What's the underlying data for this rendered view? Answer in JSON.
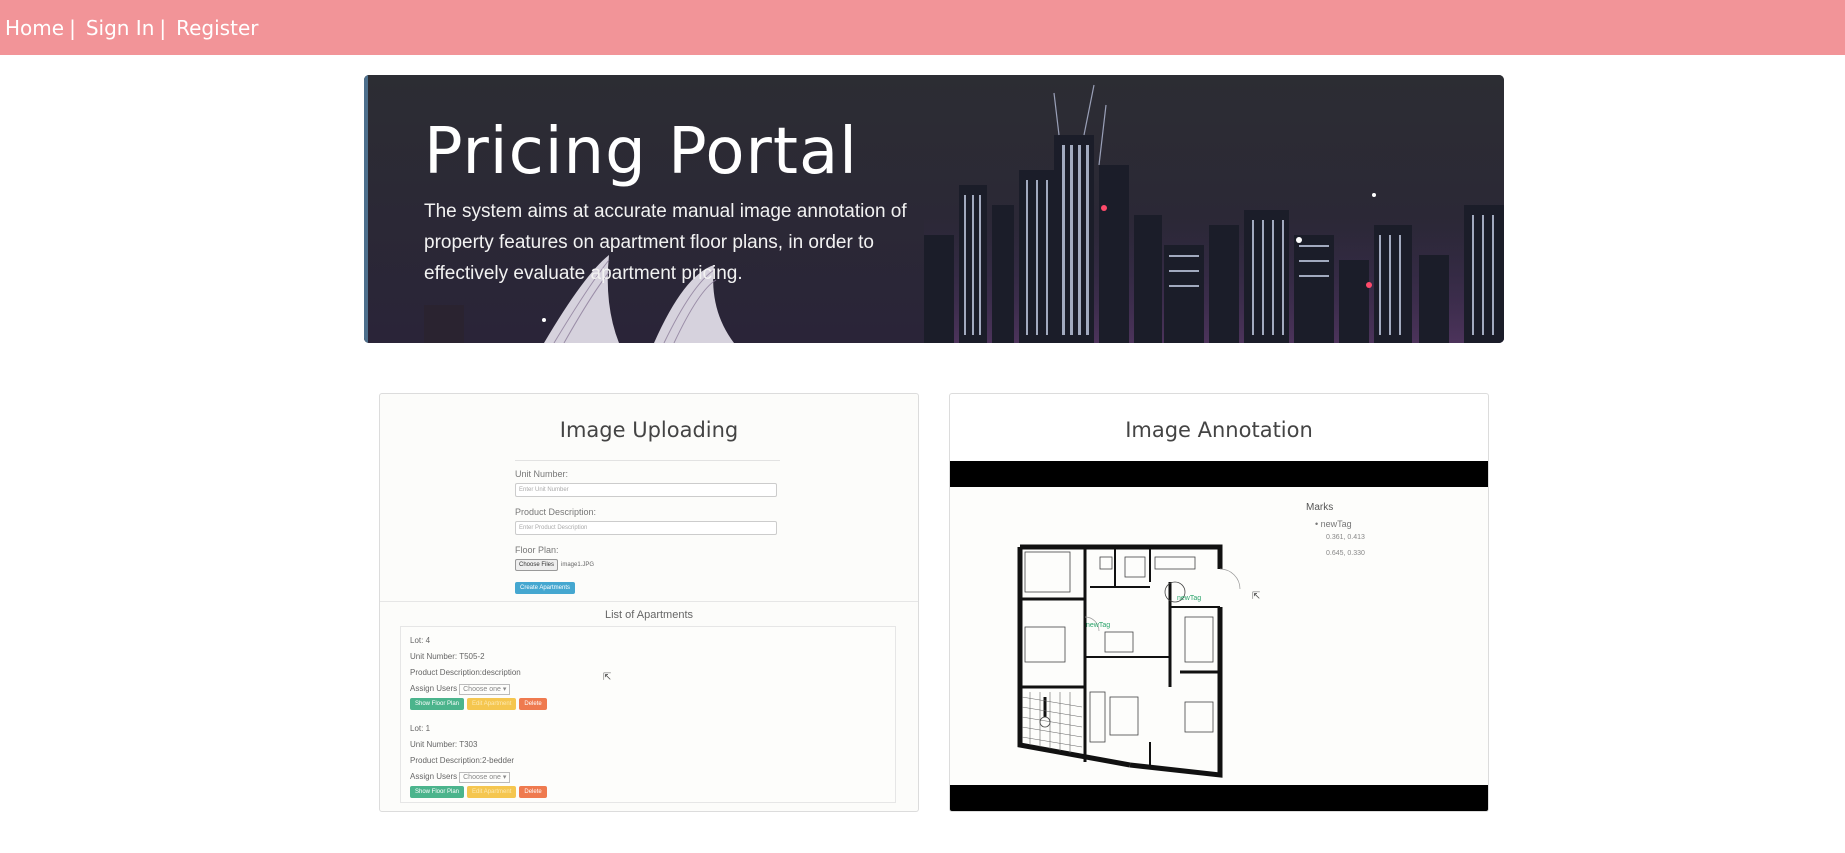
{
  "nav": {
    "home": "Home",
    "sign_in": "Sign In",
    "register": "Register",
    "separator": "|"
  },
  "hero": {
    "title": "Pricing Portal",
    "description": "The system aims at accurate manual image annotation of property features on apartment floor plans, in order to effectively evaluate apartment pricing."
  },
  "upload": {
    "title": "Image Uploading",
    "unit_label": "Unit Number:",
    "unit_placeholder": "Enter Unit Number",
    "desc_label": "Product Description:",
    "desc_placeholder": "Enter Product Description",
    "floor_label": "Floor Plan:",
    "file_button": "Choose Files",
    "file_name": "image1.JPG",
    "create_button": "Create Apartments",
    "list_title": "List of Apartments",
    "apartments": [
      {
        "lot": "Lot: 4",
        "unit": "Unit Number: T505-2",
        "desc": "Product Description:description",
        "assign": "Assign Users",
        "select": "Choose one"
      },
      {
        "lot": "Lot: 1",
        "unit": "Unit Number: T303",
        "desc": "Product Description:2-bedder",
        "assign": "Assign Users",
        "select": "Choose one"
      }
    ],
    "btn_show": "Show Floor Plan",
    "btn_edit": "Edit Apartment",
    "btn_delete": "Delete"
  },
  "annotation": {
    "title": "Image Annotation",
    "marks_title": "Marks",
    "mark_name": "newTag",
    "coord1": "0.361, 0.413",
    "coord2": "0.645, 0.330",
    "tag_label": "newTag"
  }
}
